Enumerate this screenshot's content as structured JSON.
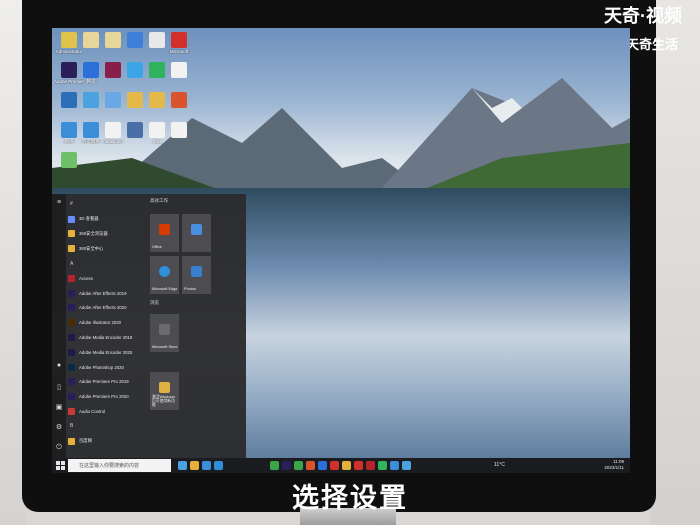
{
  "watermark": {
    "brand": "天奇·视频",
    "sub": "天奇生活"
  },
  "caption": "选择设置",
  "desktop_icons": [
    {
      "label": "Administrator",
      "color": "#e0c24a"
    },
    {
      "label": "",
      "color": "#e6d69a"
    },
    {
      "label": "",
      "color": "#e6d69a"
    },
    {
      "label": "",
      "color": "#3d7fd9"
    },
    {
      "label": "",
      "color": "#e8e8e8"
    },
    {
      "label": "Microsoft",
      "color": "#d2302a"
    },
    {
      "label": "Adobe Premiere",
      "color": "#2a1f5a"
    },
    {
      "label": "腾讯",
      "color": "#2b6fd9"
    },
    {
      "label": "",
      "color": "#8a1e4a"
    },
    {
      "label": "",
      "color": "#3aa6e8"
    },
    {
      "label": "",
      "color": "#2fb35c"
    },
    {
      "label": "",
      "color": "#f2f2f2"
    },
    {
      "label": "",
      "color": "#2c6fb8"
    },
    {
      "label": "",
      "color": "#4aa3e0"
    },
    {
      "label": "",
      "color": "#6aa7e6"
    },
    {
      "label": "",
      "color": "#e4b94a"
    },
    {
      "label": "",
      "color": "#e4b94a"
    },
    {
      "label": "",
      "color": "#d9532f"
    },
    {
      "label": "网络",
      "color": "#3a8fd8"
    },
    {
      "label": "百度网盘",
      "color": "#3a8fd8"
    },
    {
      "label": "defaig.log",
      "color": "#f2f2f2"
    },
    {
      "label": "",
      "color": "#4a6fa8"
    },
    {
      "label": "1.txt",
      "color": "#f2f2f2"
    },
    {
      "label": "",
      "color": "#f2f2f2"
    },
    {
      "label": "",
      "color": "#6fbf6a"
    }
  ],
  "start_menu": {
    "rail_icons": [
      "hamburger-icon",
      "user-icon",
      "document-icon",
      "pictures-icon",
      "settings-icon",
      "power-icon"
    ],
    "apps": [
      {
        "label": "#",
        "letter": true,
        "color": ""
      },
      {
        "label": "3D 查看器",
        "letter": false,
        "color": "#6b8cff"
      },
      {
        "label": "360安全浏览器",
        "letter": false,
        "color": "#e6b13a"
      },
      {
        "label": "360安全中心",
        "letter": false,
        "color": "#e6b13a"
      },
      {
        "label": "A",
        "letter": true,
        "color": ""
      },
      {
        "label": "Access",
        "letter": false,
        "color": "#b5242a"
      },
      {
        "label": "Adobe After Effects 2019",
        "letter": false,
        "color": "#2a1d5a"
      },
      {
        "label": "Adobe After Effects 2020",
        "letter": false,
        "color": "#2a1d5a"
      },
      {
        "label": "Adobe Illustrator 2020",
        "letter": false,
        "color": "#4a2a00"
      },
      {
        "label": "Adobe Media Encoder 2019",
        "letter": false,
        "color": "#1e1a4a"
      },
      {
        "label": "Adobe Media Encoder 2020",
        "letter": false,
        "color": "#1e1a4a"
      },
      {
        "label": "Adobe Photoshop 2020",
        "letter": false,
        "color": "#0a2a4a"
      },
      {
        "label": "Adobe Premiere Pro 2019",
        "letter": false,
        "color": "#2a1d5a"
      },
      {
        "label": "Adobe Premiere Pro 2020",
        "letter": false,
        "color": "#2a1d5a"
      },
      {
        "label": "Audio Control",
        "letter": false,
        "color": "#c83a3a"
      },
      {
        "label": "B",
        "letter": true,
        "color": ""
      },
      {
        "label": "百度网",
        "letter": false,
        "color": "#e6b13a"
      }
    ],
    "tiles_heading": "高效工作",
    "section2": "浏览",
    "tiles": [
      {
        "label": "Office",
        "color": "#d83b01"
      },
      {
        "label": "",
        "color": "#4a8fe0"
      },
      {
        "label": "Microsoft Edge",
        "color": "#2f8fd8"
      },
      {
        "label": "Photos",
        "color": "#3a7ed0"
      },
      {
        "label": "Microsoft Store",
        "color": "#3a3a3a"
      },
      {
        "label": "激活Windows 后可使用新功能",
        "color": "#e0b040"
      }
    ]
  },
  "taskbar": {
    "search_placeholder": "在这里输入你要搜索的内容",
    "weather": "11°C",
    "time": "11:09",
    "date": "2023/1/11",
    "icons": [
      "#4aa3e0",
      "#e6b13a",
      "#3a8fd8",
      "#2f8fd8",
      "#3aa64a",
      "#2a1f5a",
      "#3aa64a",
      "#d9532f",
      "#2b6fd9",
      "#d2302a",
      "#e6b13a",
      "#d2302a",
      "#b5242a",
      "#2fb35c",
      "#3a8fd8",
      "#4aa3e0"
    ]
  }
}
